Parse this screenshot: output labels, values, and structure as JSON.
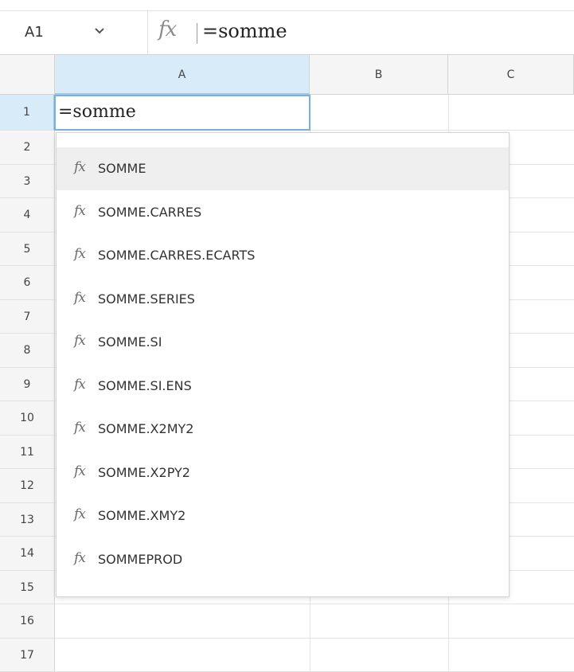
{
  "formula_bar": {
    "name_box": "A1",
    "fx_icon": "fx",
    "formula": "=somme"
  },
  "columns": [
    {
      "label": "A",
      "selected": true
    },
    {
      "label": "B",
      "selected": false
    },
    {
      "label": "C",
      "selected": false
    }
  ],
  "rows": [
    "1",
    "2",
    "3",
    "4",
    "5",
    "6",
    "7",
    "8",
    "9",
    "10",
    "11",
    "12",
    "13",
    "14",
    "15",
    "16",
    "17"
  ],
  "active_cell": {
    "ref": "A1",
    "value": "=somme"
  },
  "autocomplete": {
    "icon": "fx",
    "items": [
      "SOMME",
      "SOMME.CARRES",
      "SOMME.CARRES.ECARTS",
      "SOMME.SERIES",
      "SOMME.SI",
      "SOMME.SI.ENS",
      "SOMME.X2MY2",
      "SOMME.X2PY2",
      "SOMME.XMY2",
      "SOMMEPROD"
    ],
    "highlighted_index": 0
  },
  "colors": {
    "selection_header": "#d8ebf8",
    "selection_border": "#7ab0de",
    "header_bg": "#f5f5f5",
    "highlight_item": "#efefef"
  }
}
